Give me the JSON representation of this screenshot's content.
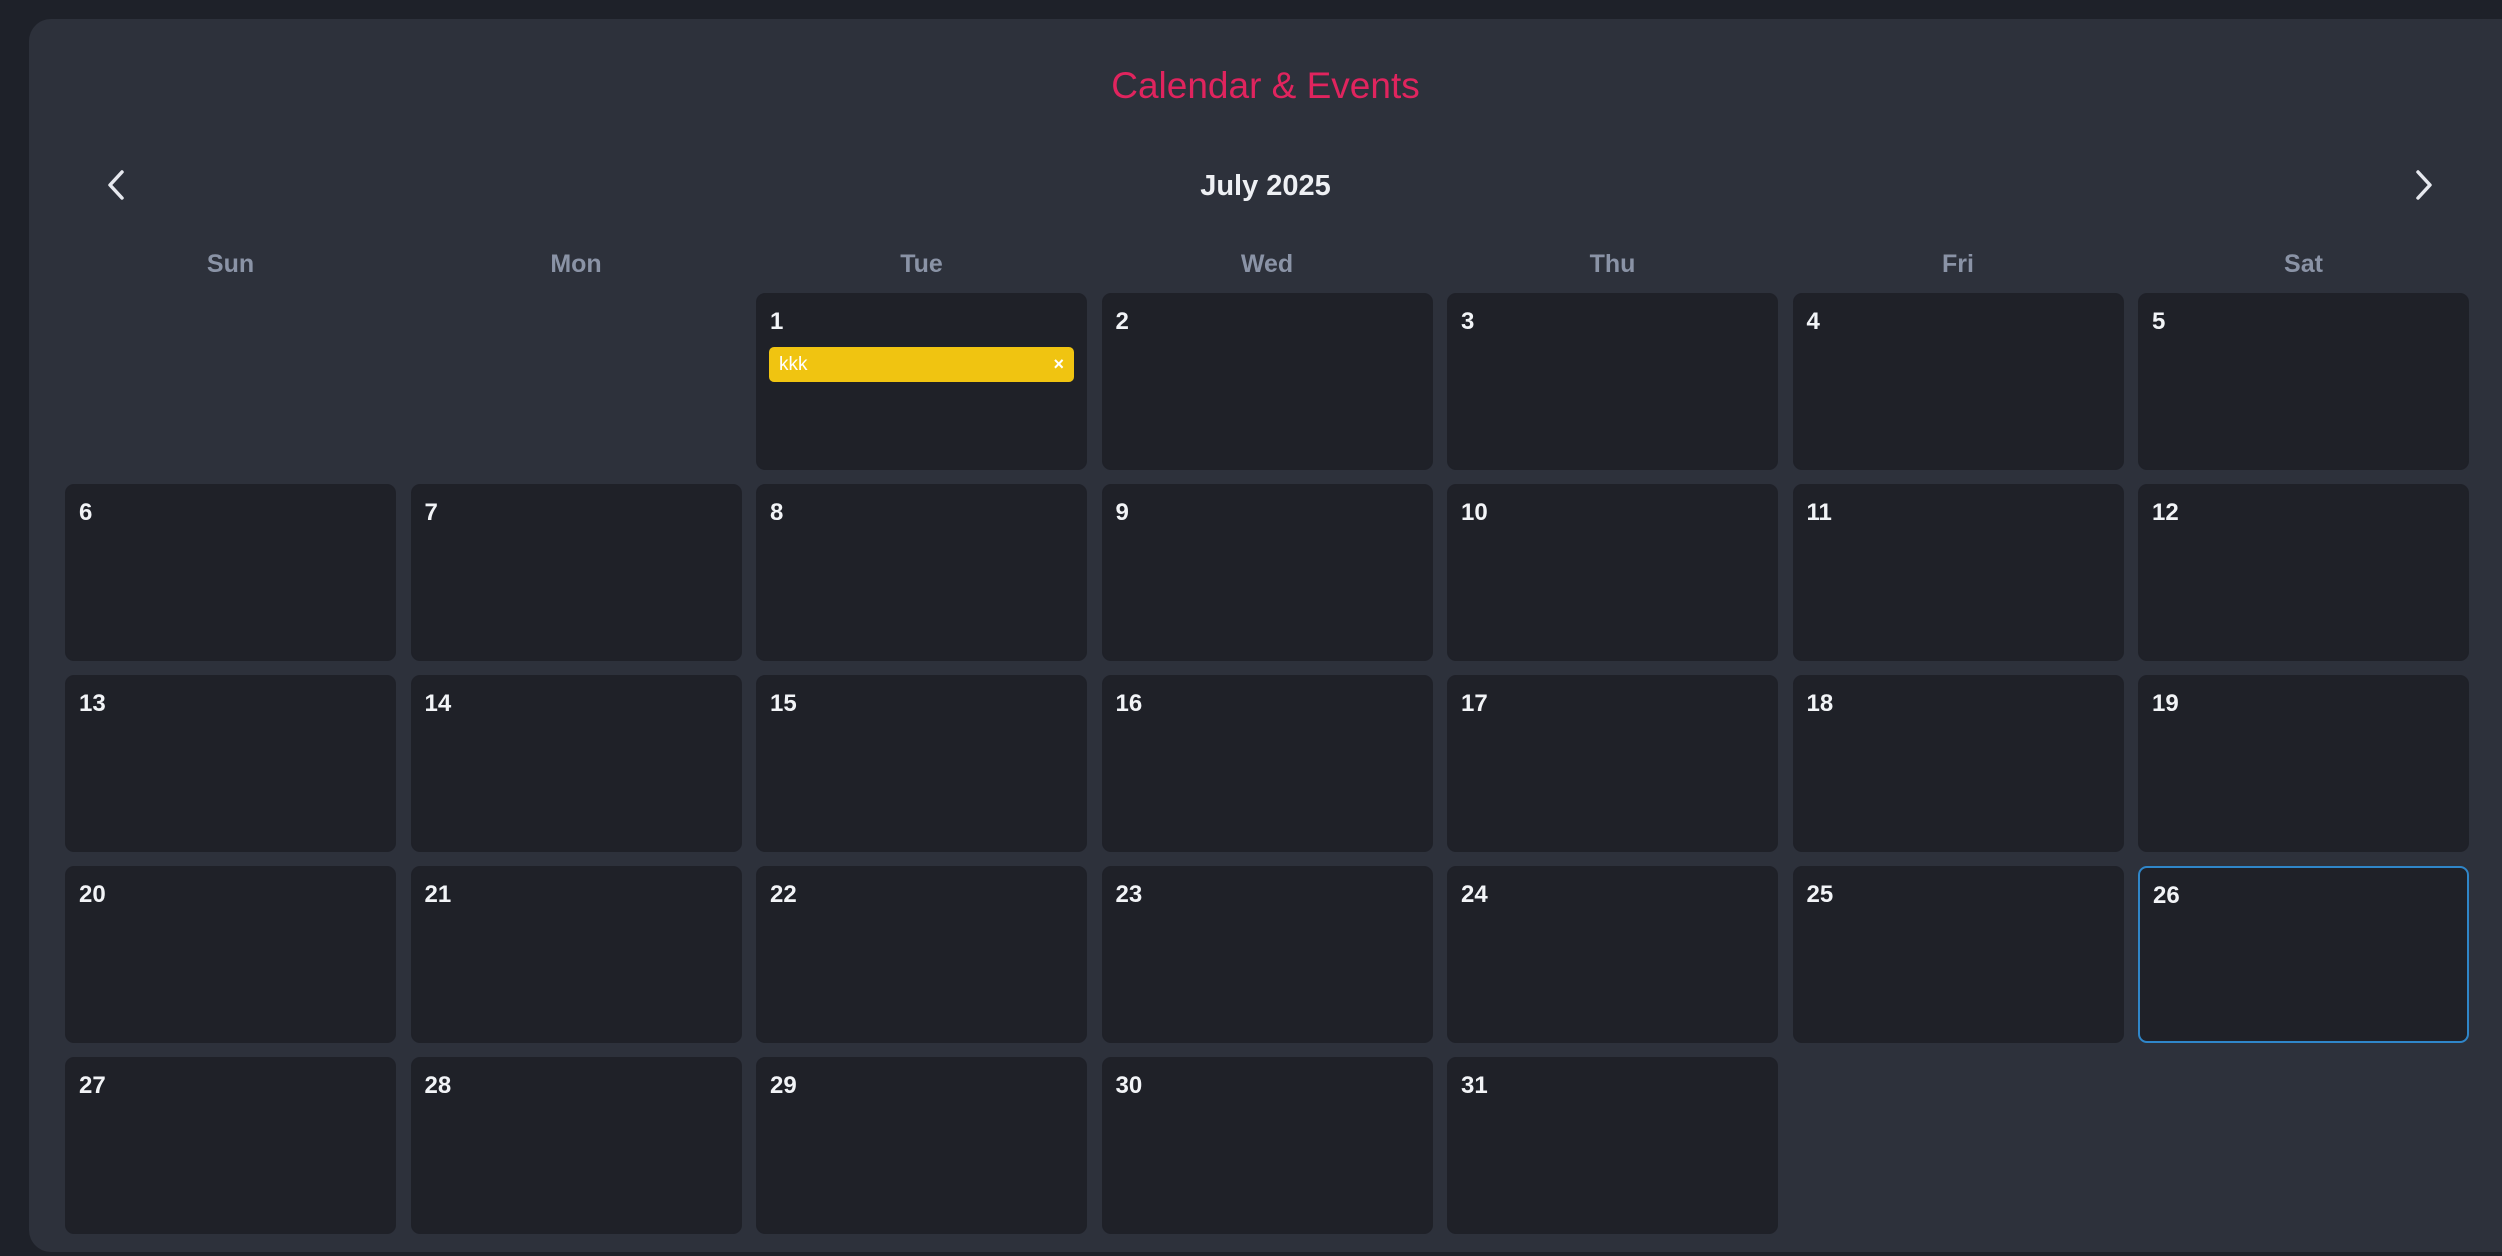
{
  "app": {
    "title": "Calendar & Events",
    "accent_color": "#e0245e"
  },
  "nav": {
    "prev_icon": "chevron-left-icon",
    "next_icon": "chevron-right-icon",
    "month_label": "July 2025"
  },
  "weekdays": [
    "Sun",
    "Mon",
    "Tue",
    "Wed",
    "Thu",
    "Fri",
    "Sat"
  ],
  "calendar": {
    "leading_empty_days": 2,
    "days_in_month": 31,
    "today": 26,
    "today_border_color": "#2f86c9",
    "events": [
      {
        "day": 1,
        "label": "kkk",
        "remove_label": "×",
        "color": "#f0c411"
      }
    ]
  }
}
